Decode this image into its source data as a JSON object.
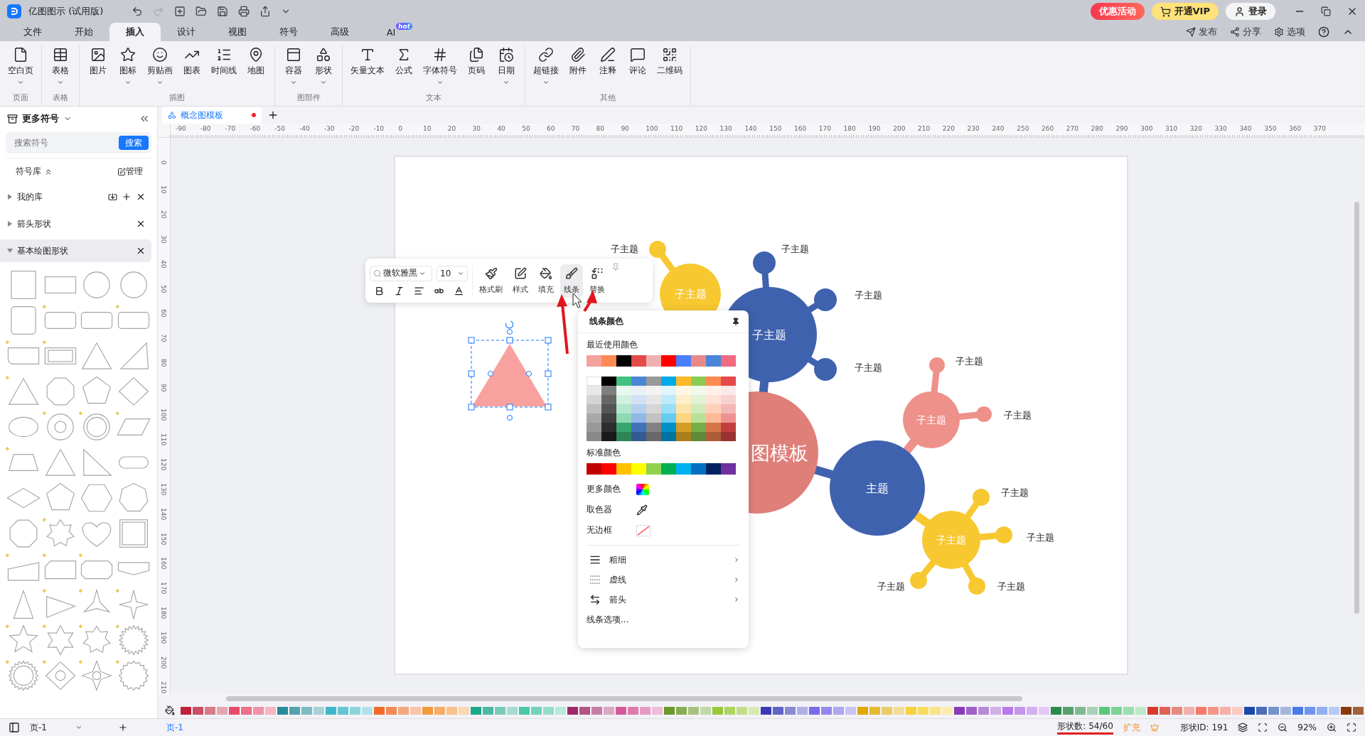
{
  "app": {
    "title": "亿图图示 (试用版)"
  },
  "header_buttons": {
    "promo": "优惠活动",
    "vip": "开通VIP",
    "login": "登录"
  },
  "tabs": [
    {
      "label": "文件",
      "selected": false
    },
    {
      "label": "开始",
      "selected": false
    },
    {
      "label": "插入",
      "selected": true
    },
    {
      "label": "设计",
      "selected": false
    },
    {
      "label": "视图",
      "selected": false
    },
    {
      "label": "符号",
      "selected": false
    },
    {
      "label": "高级",
      "selected": false
    },
    {
      "label": "AI",
      "selected": false,
      "badge": "hot"
    }
  ],
  "tab_actions": [
    "发布",
    "分享",
    "选项"
  ],
  "ribbon": [
    {
      "group": "页面",
      "items": [
        {
          "label": "空白页",
          "dropdown": true
        }
      ]
    },
    {
      "group": "表格",
      "items": [
        {
          "label": "表格",
          "dropdown": true
        }
      ]
    },
    {
      "group": "插图",
      "items": [
        {
          "label": "图片",
          "dropdown": false
        },
        {
          "label": "图标",
          "dropdown": true
        },
        {
          "label": "剪贴画",
          "dropdown": true
        },
        {
          "label": "图表",
          "dropdown": false
        },
        {
          "label": "时间线",
          "dropdown": false
        },
        {
          "label": "地图",
          "dropdown": false
        }
      ]
    },
    {
      "group": "图部件",
      "items": [
        {
          "label": "容器",
          "dropdown": true
        },
        {
          "label": "形状",
          "dropdown": true
        }
      ]
    },
    {
      "group": "文本",
      "items": [
        {
          "label": "矢量文本",
          "dropdown": false
        },
        {
          "label": "公式",
          "dropdown": false
        },
        {
          "label": "字体符号",
          "dropdown": true
        },
        {
          "label": "页码",
          "dropdown": false
        },
        {
          "label": "日期",
          "dropdown": true
        }
      ]
    },
    {
      "group": "其他",
      "items": [
        {
          "label": "超链接",
          "dropdown": true
        },
        {
          "label": "附件",
          "dropdown": false
        },
        {
          "label": "注释",
          "dropdown": false
        },
        {
          "label": "评论",
          "dropdown": false
        },
        {
          "label": "二维码",
          "dropdown": false
        }
      ]
    }
  ],
  "sidebar": {
    "title": "更多符号",
    "search": {
      "placeholder": "搜索符号",
      "button": "搜索"
    },
    "library_label": "符号库",
    "manage": "管理",
    "libraries": [
      {
        "name": "我的库",
        "expanded": false
      },
      {
        "name": "箭头形状",
        "expanded": false
      },
      {
        "name": "基本绘图形状",
        "expanded": true
      }
    ]
  },
  "document_tabs": [
    {
      "label": "概念图模板",
      "modified": true
    }
  ],
  "ruler": {
    "horizontal": [
      "-90",
      "-80",
      "-70",
      "-60",
      "-50",
      "-40",
      "-30",
      "-20",
      "-10",
      "0",
      "10",
      "20",
      "30",
      "40",
      "50",
      "60",
      "70",
      "80",
      "90",
      "100",
      "110",
      "120",
      "130",
      "140",
      "150",
      "160",
      "170",
      "180",
      "190",
      "200",
      "210",
      "220",
      "230",
      "240",
      "250",
      "260",
      "270",
      "280",
      "290",
      "300",
      "310",
      "320",
      "330",
      "340",
      "350",
      "360",
      "370"
    ],
    "vertical": [
      "0",
      "10",
      "20",
      "30",
      "40",
      "50",
      "60",
      "70",
      "80",
      "90",
      "100",
      "110",
      "120",
      "130",
      "140",
      "150",
      "160",
      "170",
      "180",
      "190",
      "200",
      "210"
    ]
  },
  "mind_map": {
    "topics": [
      {
        "label": "子主题",
        "color": "#f7c830"
      },
      {
        "label": "子主题",
        "color": "#3f62ae"
      },
      {
        "label": "图模板",
        "color": "#df7f7a"
      },
      {
        "label": "主题",
        "color": "#3f62ae"
      },
      {
        "label": "子主题",
        "color": "#ee918a"
      },
      {
        "label": "子主题",
        "color": "#f7c830"
      }
    ],
    "subtopics": [
      "子主题",
      "子主题",
      "子主题",
      "子主题",
      "子主题",
      "子主题",
      "子主题",
      "子主题",
      "子主题",
      "子主题"
    ]
  },
  "floating_toolbar": {
    "font": "微软雅黑",
    "size": "10",
    "tools": [
      {
        "label": "格式刷",
        "selected": false
      },
      {
        "label": "样式",
        "selected": false
      },
      {
        "label": "填充",
        "selected": false
      },
      {
        "label": "线条",
        "selected": true
      },
      {
        "label": "替换",
        "selected": false
      }
    ]
  },
  "line_color_menu": {
    "title": "线条颜色",
    "recent_label": "最近使用颜色",
    "standard_label": "标准颜色",
    "options": [
      "更多颜色",
      "取色器",
      "无边框"
    ],
    "submenus": [
      "粗细",
      "虚线",
      "箭头"
    ],
    "more": "线条选项..."
  },
  "pages": {
    "selector": "页-1",
    "tabs": [
      {
        "label": "页-1",
        "selected": true
      }
    ]
  },
  "status": {
    "shape_count": "形状数: 54/60",
    "expand": "扩充",
    "shape_id": "形状ID: 191",
    "zoom": "92%"
  }
}
